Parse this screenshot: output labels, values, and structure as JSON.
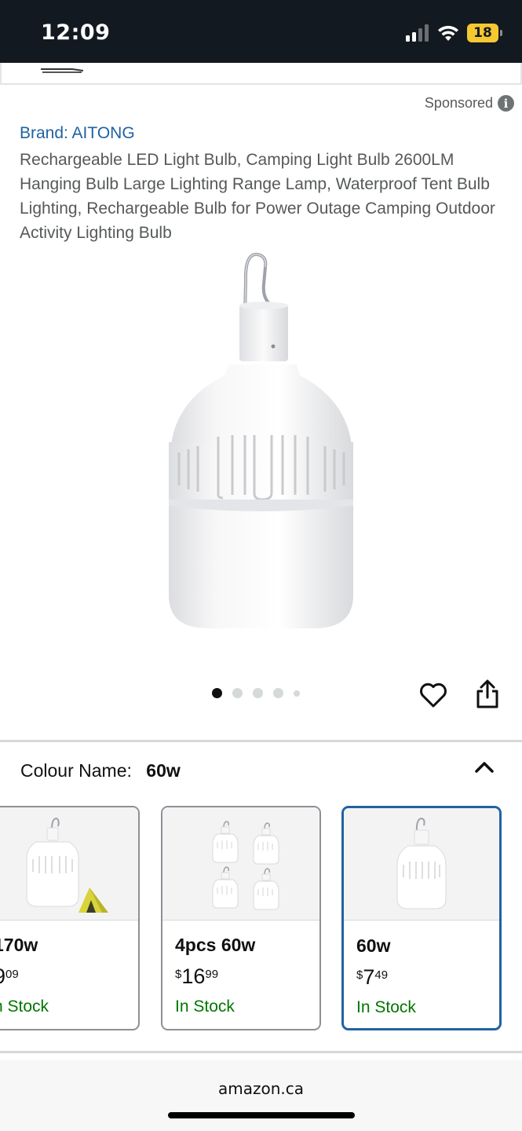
{
  "status_bar": {
    "time": "12:09",
    "battery": "18"
  },
  "sponsored": {
    "label": "Sponsored",
    "info_glyph": "i"
  },
  "product": {
    "brand": "Brand: AITONG",
    "title": "Rechargeable LED Light Bulb, Camping Light Bulb 2600LM Hanging Bulb Large Lighting Range Lamp, Waterproof Tent Bulb Lighting, Rechargeable Bulb for Power Outage Camping Outdoor Activity Lighting Bulb",
    "image_icon": "hanging-led-bulb-image",
    "carousel": {
      "total_images": 5,
      "current_index": 1
    }
  },
  "actions": {
    "wishlist_icon": "heart-icon",
    "share_icon": "share-icon"
  },
  "variant_selector": {
    "label": "Colour Name:",
    "selected_value": "60w",
    "expanded": true,
    "options": [
      {
        "name": "170w",
        "price_currency": "",
        "price_whole": "9",
        "price_cents": "09",
        "stock": "n Stock",
        "selected": false
      },
      {
        "name": "4pcs 60w",
        "price_currency": "$",
        "price_whole": "16",
        "price_cents": "99",
        "stock": "In Stock",
        "selected": false
      },
      {
        "name": "60w",
        "price_currency": "$",
        "price_whole": "7",
        "price_cents": "49",
        "stock": "In Stock",
        "selected": true
      }
    ]
  },
  "footer": {
    "domain": "amazon.ca"
  },
  "colors": {
    "header_bg": "#131921",
    "link": "#2162a1",
    "stock_green": "#007600",
    "selected_border": "#2162a1",
    "battery": "#f5c731"
  }
}
